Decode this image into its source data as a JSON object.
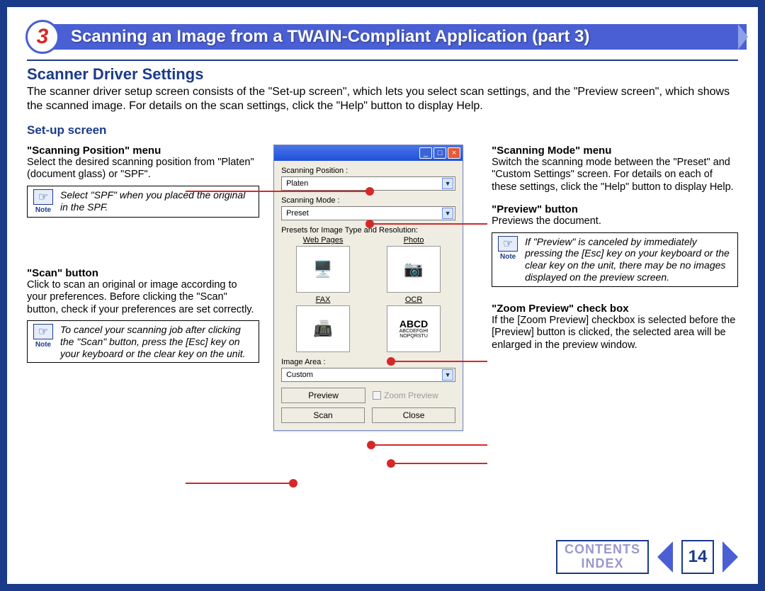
{
  "chapter": {
    "number": "3",
    "title": "Scanning an Image from a TWAIN-Compliant Application (part 3)"
  },
  "headings": {
    "driver": "Scanner Driver Settings",
    "setup": "Set-up screen"
  },
  "intro": "The scanner driver setup screen consists of the \"Set-up screen\", which lets you select scan settings, and the \"Preview screen\", which shows the scanned image. For details on the scan settings, click the \"Help\" button to display Help.",
  "left": {
    "scanpos": {
      "title": "\"Scanning Position\" menu",
      "text": "Select the desired scanning position from \"Platen\" (document glass) or \"SPF\".",
      "note": "Select \"SPF\" when you placed the original in the SPF."
    },
    "scan": {
      "title": "\"Scan\" button",
      "text": "Click to scan an original or image according to your preferences. Before clicking the \"Scan\" button, check if your preferences are set correctly.",
      "note": "To cancel your scanning job after clicking the \"Scan\" button, press the [Esc] key on your keyboard or the clear key on the unit."
    }
  },
  "right": {
    "mode": {
      "title": "\"Scanning Mode\" menu",
      "text": "Switch the scanning mode between the \"Preset\" and \"Custom Settings\" screen. For details on each of these settings, click the \"Help\" button to display Help."
    },
    "preview": {
      "title": "\"Preview\" button",
      "text": "Previews the document.",
      "note": "If \"Preview\" is canceled by immediately pressing the [Esc] key on your keyboard or the clear key on the unit, there may be no images displayed on the preview screen."
    },
    "zoom": {
      "title": "\"Zoom Preview\" check box",
      "text": "If the [Zoom Preview] checkbox is selected before the [Preview] button is clicked, the selected area will be enlarged in the preview window."
    }
  },
  "win": {
    "scanpos_label": "Scanning Position :",
    "scanpos_value": "Platen",
    "mode_label": "Scanning Mode :",
    "mode_value": "Preset",
    "presets_label": "Presets for Image Type and Resolution:",
    "presets": {
      "web": "Web Pages",
      "photo": "Photo",
      "fax": "FAX",
      "ocr": "OCR",
      "ocr_small": "ABCDEFGH\nIJKLMNO\nNOPQRSTU"
    },
    "imagearea_label": "Image Area :",
    "imagearea_value": "Custom",
    "buttons": {
      "preview": "Preview",
      "zoom": "Zoom Preview",
      "scan": "Scan",
      "close": "Close"
    }
  },
  "note_label": "Note",
  "nav": {
    "contents": "CONTENTS",
    "index": "INDEX",
    "page": "14"
  }
}
